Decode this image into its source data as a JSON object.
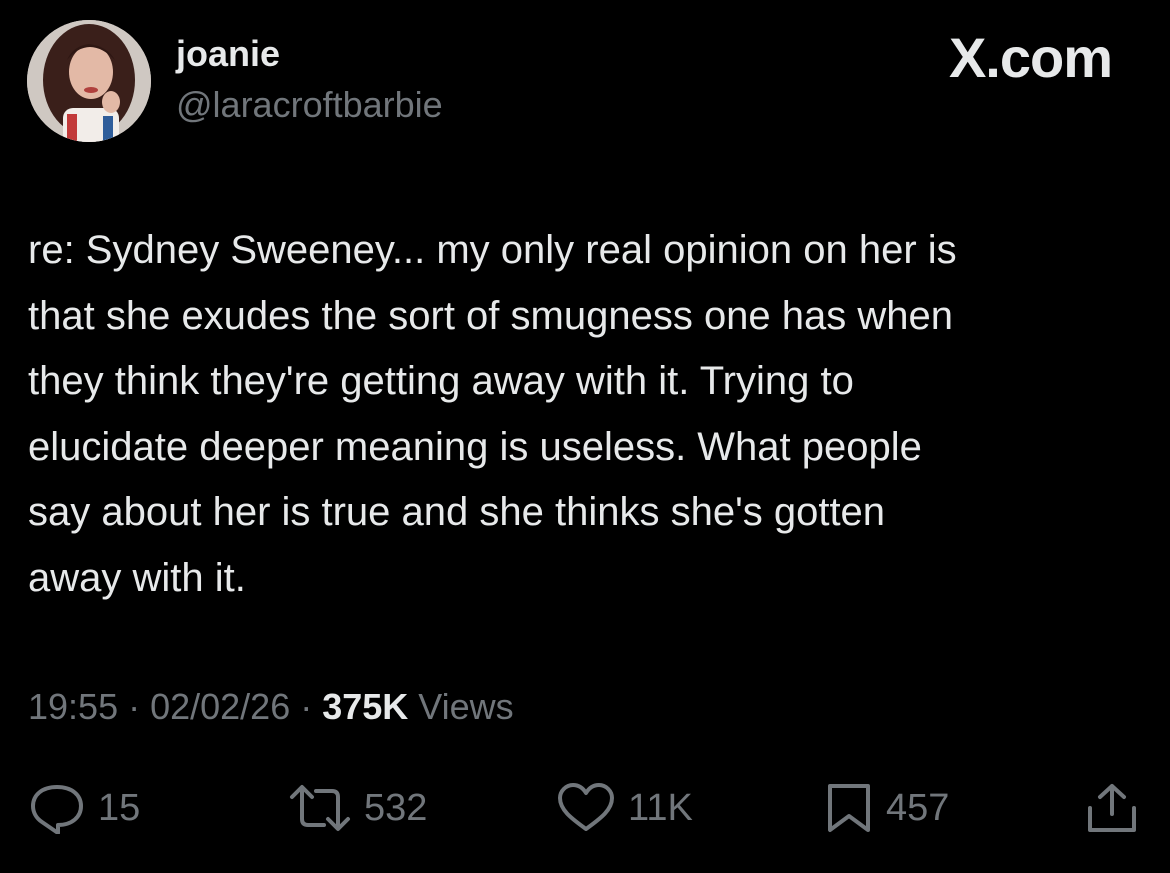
{
  "author": {
    "display_name": "joanie",
    "handle": "@laracroftbarbie"
  },
  "brand": "X.com",
  "tweet": {
    "lines": [
      "re: Sydney Sweeney... my only real opinion on her is",
      "that she exudes the sort of smugness one has when",
      "they think they're getting away with it. Trying to",
      "elucidate deeper meaning is useless. What people",
      "say about her is true and she thinks she's gotten",
      "away with it."
    ]
  },
  "meta": {
    "time": "19:55",
    "separator": " · ",
    "date": "02/02/26",
    "views_count": "375K",
    "views_label": " Views"
  },
  "actions": {
    "replies": "15",
    "reposts": "532",
    "likes": "11K",
    "bookmarks": "457"
  },
  "icons": {
    "reply": "reply-icon",
    "repost": "repost-icon",
    "like": "heart-icon",
    "bookmark": "bookmark-icon",
    "share": "share-icon"
  },
  "colors": {
    "background": "#000000",
    "primary_text": "#e7e9ea",
    "secondary_text": "#71767b"
  }
}
